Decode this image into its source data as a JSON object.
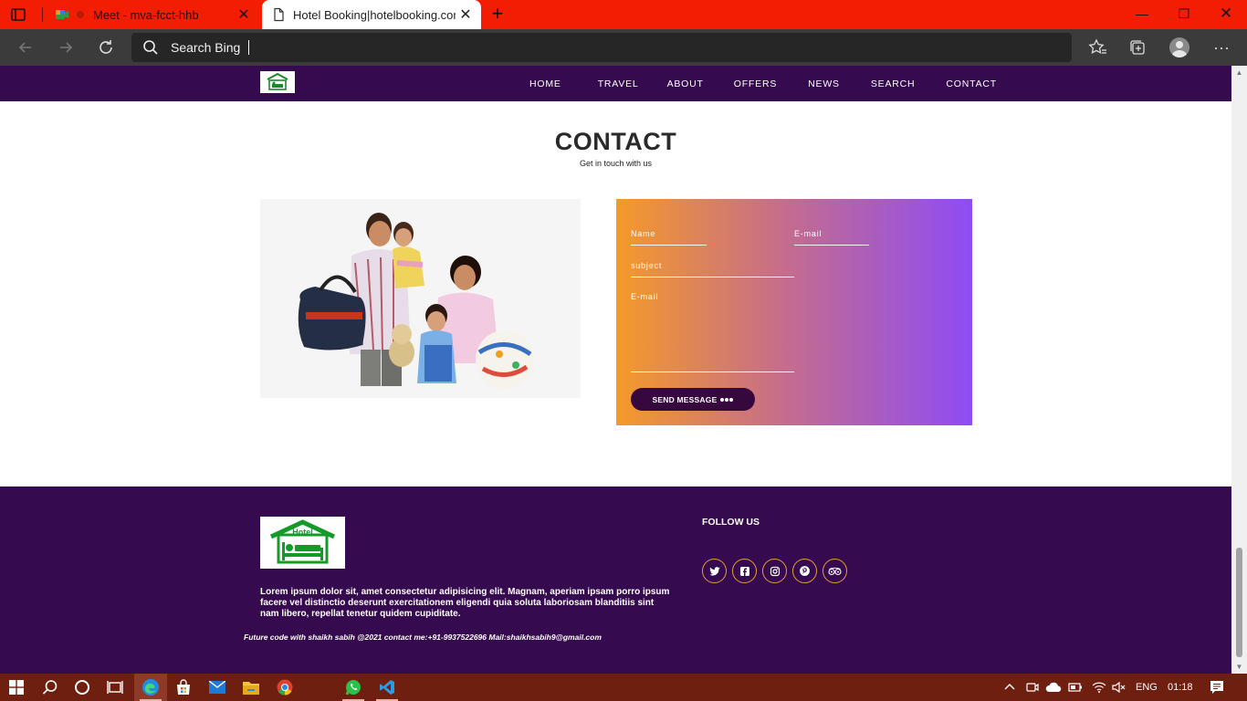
{
  "browser": {
    "tabs": [
      {
        "title": "Meet - mva-fcct-hhb",
        "active": false
      },
      {
        "title": "Hotel Booking|hotelbooking.com",
        "active": true
      }
    ],
    "search_placeholder": "Search Bing",
    "accent_color": "#f21d02"
  },
  "nav": {
    "items": [
      {
        "label": "HOME"
      },
      {
        "label": "TRAVEL"
      },
      {
        "label": "ABOUT"
      },
      {
        "label": "OFFERS"
      },
      {
        "label": "NEWS"
      },
      {
        "label": "SEARCH"
      },
      {
        "label": "CONTACT"
      }
    ],
    "background": "#360a4e"
  },
  "contact": {
    "title": "CONTACT",
    "subtitle": "Get in touch with us",
    "form": {
      "name_label": "Name",
      "email_label": "E-mail",
      "subject_label": "subject",
      "message_label": "E-mail",
      "send_label": "SEND MESSAGE"
    }
  },
  "footer": {
    "logo_text": "Hotel",
    "description": "Lorem ipsum dolor sit, amet consectetur adipisicing elit. Magnam, aperiam ipsam porro ipsum facere vel distinctio deserunt exercitationem eligendi quia soluta laboriosam blanditiis sint nam libero, repellat tenetur quidem cupiditate.",
    "copyright": "Future code with shaikh sabih @2021 contact me:+91-9937522696 Mail:shaikhsabih9@gmail.com",
    "follow_label": "FOLLOW US",
    "socials": [
      "twitter-icon",
      "facebook-icon",
      "instagram-icon",
      "pinterest-icon",
      "tripadvisor-icon"
    ]
  },
  "taskbar": {
    "language": "ENG",
    "time": "01:18"
  }
}
